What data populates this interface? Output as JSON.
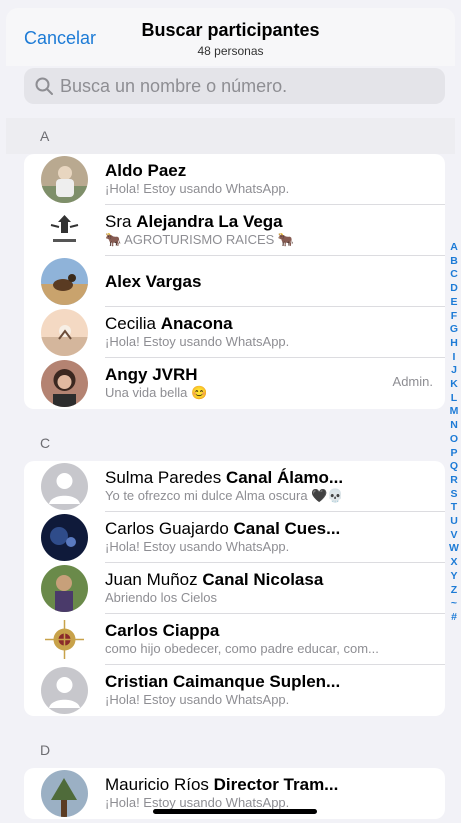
{
  "header": {
    "cancel_label": "Cancelar",
    "title": "Buscar participantes",
    "subtitle": "48 personas"
  },
  "search": {
    "placeholder": "Busca un nombre o número."
  },
  "sections": [
    {
      "letter": "A",
      "contacts": [
        {
          "prefix": "",
          "bold": "Aldo Paez",
          "status": "¡Hola! Estoy usando WhatsApp.",
          "avatar": "photo-man"
        },
        {
          "prefix": "Sra ",
          "bold": "Alejandra La Vega",
          "status": "🐂 AGROTURISMO RAICES 🐂",
          "avatar": "logo-raices"
        },
        {
          "prefix": "",
          "bold": "Alex Vargas",
          "status": "",
          "avatar": "photo-horse"
        },
        {
          "prefix": "Cecilia ",
          "bold": "Anacona",
          "status": "¡Hola! Estoy usando WhatsApp.",
          "avatar": "photo-sunset"
        },
        {
          "prefix": "",
          "bold": "Angy JVRH",
          "status": "Una vida bella 😊",
          "avatar": "photo-woman",
          "admin": "Admin."
        }
      ]
    },
    {
      "letter": "C",
      "contacts": [
        {
          "prefix": "Sulma Paredes ",
          "bold": "Canal Álamo...",
          "status": "Yo te ofrezco mi dulce Alma oscura 🖤💀",
          "avatar": "placeholder"
        },
        {
          "prefix": "Carlos Guajardo ",
          "bold": "Canal Cues...",
          "status": "¡Hola! Estoy usando WhatsApp.",
          "avatar": "photo-dark"
        },
        {
          "prefix": "Juan Muñoz ",
          "bold": "Canal Nicolasa",
          "status": "Abriendo los Cielos",
          "avatar": "photo-outdoor"
        },
        {
          "prefix": "",
          "bold": "Carlos Ciappa",
          "status": "como hijo obedecer, como padre educar, com...",
          "avatar": "photo-ornament"
        },
        {
          "prefix": "",
          "bold": "Cristian Caimanque Suplen...",
          "status": "¡Hola! Estoy usando WhatsApp.",
          "avatar": "placeholder"
        }
      ]
    },
    {
      "letter": "D",
      "contacts": [
        {
          "prefix": "Mauricio Ríos ",
          "bold": "Director Tram...",
          "status": "¡Hola! Estoy usando WhatsApp.",
          "avatar": "photo-tree"
        }
      ]
    }
  ],
  "index_letters": [
    "A",
    "B",
    "C",
    "D",
    "E",
    "F",
    "G",
    "H",
    "I",
    "J",
    "K",
    "L",
    "M",
    "N",
    "O",
    "P",
    "Q",
    "R",
    "S",
    "T",
    "U",
    "V",
    "W",
    "X",
    "Y",
    "Z",
    "~",
    "#"
  ],
  "colors": {
    "accent": "#1d7bd6",
    "background": "#f2f2f7",
    "secondary_text": "#8e8e93"
  },
  "icons": {
    "search": "search-icon",
    "placeholder_avatar": "person-placeholder-icon"
  }
}
